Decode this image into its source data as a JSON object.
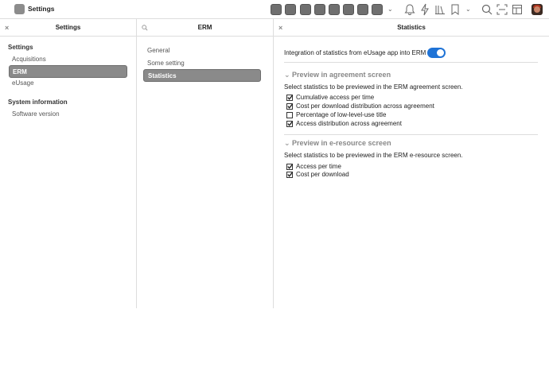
{
  "app": {
    "title": "Settings"
  },
  "toolbar": {
    "app_buttons_count": 8,
    "icons": [
      "bell-icon",
      "lightning-icon",
      "library-icon",
      "bookmark-icon",
      "search-icon",
      "scan-icon",
      "layout-icon"
    ]
  },
  "left_pane": {
    "header": "Settings",
    "section1": "Settings",
    "items": [
      "Acquisitions",
      "ERM",
      "eUsage"
    ],
    "active_item": "ERM",
    "section2": "System information",
    "items2": [
      "Software version"
    ]
  },
  "mid_pane": {
    "header": "ERM",
    "items": [
      "General",
      "Some setting",
      "Statistics"
    ],
    "active_item": "Statistics"
  },
  "right_pane": {
    "header": "Statistics",
    "integration_label": "Integration of statistics from  eUsage app into ERM",
    "integration_enabled": true,
    "agreement": {
      "title": "Preview in agreement screen",
      "description": "Select statistics to be previewed in the ERM agreement screen.",
      "options": [
        {
          "label": "Cumulative access per time",
          "checked": true
        },
        {
          "label": "Cost per download distribution across agreement",
          "checked": true
        },
        {
          "label": "Percentage of low-level-use title",
          "checked": false
        },
        {
          "label": "Access distribution across agreement",
          "checked": true
        }
      ]
    },
    "eresource": {
      "title": "Preview in e-resource screen",
      "description": "Select statistics to be previewed in the ERM e-resource screen.",
      "options": [
        {
          "label": "Access per time",
          "checked": true
        },
        {
          "label": "Cost per download",
          "checked": true
        }
      ]
    }
  },
  "colors": {
    "accent": "#1f73d6",
    "active_nav": "#8a8a8a"
  }
}
